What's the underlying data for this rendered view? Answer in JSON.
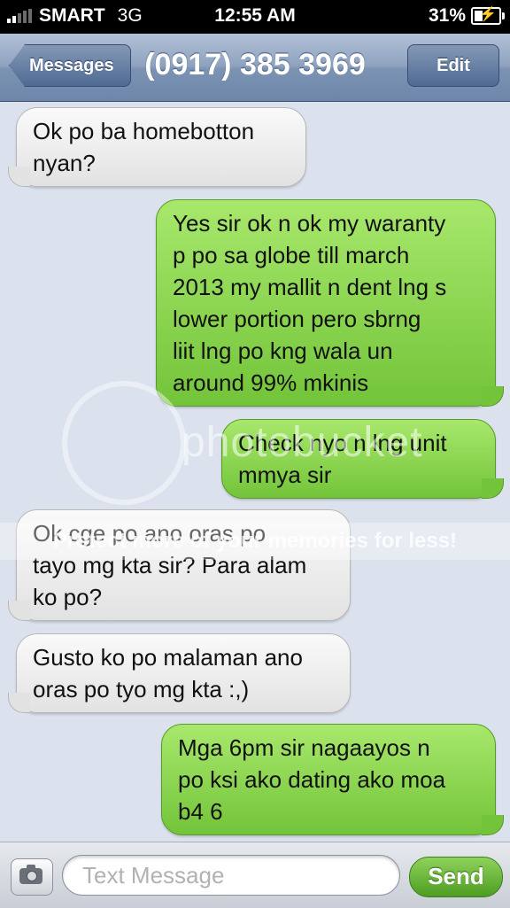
{
  "status_bar": {
    "carrier": "SMART",
    "network": "3G",
    "time": "12:55 AM",
    "battery": "31%",
    "battery_level": 0.31,
    "signal_bars": 2,
    "icons": [
      "signal-bars-icon",
      "battery-charging-icon"
    ]
  },
  "nav": {
    "back_label": "Messages",
    "title": "(0917) 385 3969",
    "edit_label": "Edit"
  },
  "messages": [
    {
      "direction": "incoming",
      "text": "Ok po ba homebotton\nnyan?"
    },
    {
      "direction": "outgoing",
      "text": "Yes sir ok n ok my waranty\np po sa globe till march\n2013 my mallit n dent lng s\nlower portion pero sbrng\nliit lng po kng wala un\naround 99% mkinis"
    },
    {
      "direction": "outgoing",
      "text": "Check nyo n lng unit\nmmya sir"
    },
    {
      "direction": "incoming",
      "text": "Ok cge po ano oras po\ntayo mg kta sir? Para alam\nko po?"
    },
    {
      "direction": "incoming",
      "text": "Gusto ko po malaman ano\noras po tyo mg kta :,)"
    },
    {
      "direction": "outgoing",
      "text": "Mga 6pm sir nagaayos n\npo ksi ako dating ako moa\nb4 6"
    }
  ],
  "watermark": {
    "brand": "photobucket",
    "tagline": "Protect more of your memories for less!"
  },
  "input_bar": {
    "placeholder": "Text Message",
    "value": "",
    "send_label": "Send",
    "camera_icon": "camera-icon"
  },
  "colors": {
    "incoming_bubble": "#e8e8e8",
    "outgoing_bubble": "#8fd65a",
    "nav_bar": "#7f96b6",
    "background": "#dbe2ed",
    "send_button": "#5fb030"
  }
}
